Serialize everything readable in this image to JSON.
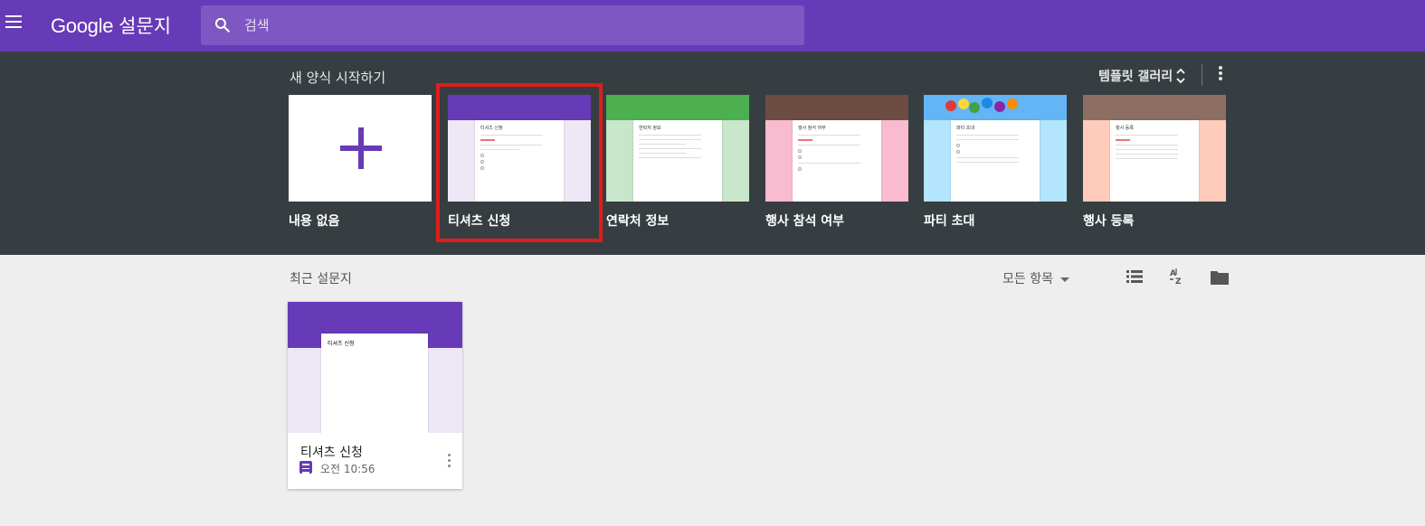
{
  "app": {
    "brand_google": "Google",
    "brand_product": "설문지",
    "accent_color": "#673ab7",
    "menu_icon": "hamburger-menu-icon"
  },
  "search": {
    "placeholder": "검색",
    "icon": "search-icon"
  },
  "templates": {
    "section_title": "새 양식 시작하기",
    "gallery_label": "템플릿 갤러리",
    "highlight_color": "#e21b1b",
    "items": [
      {
        "label": "내용 없음",
        "icon": "plus-icon"
      },
      {
        "label": "티셔츠 신청",
        "paper_title": "티셔츠 신청",
        "colors": [
          "#673ab7",
          "#ede7f6"
        ]
      },
      {
        "label": "연락처 정보",
        "paper_title": "연락처 정보",
        "colors": [
          "#4caf50",
          "#c8e6c9"
        ]
      },
      {
        "label": "행사 참석 여부",
        "paper_title": "행사 참석 여부",
        "colors": [
          "#6d4c41",
          "#f8bbd0"
        ]
      },
      {
        "label": "파티 초대",
        "paper_title": "파티 초대",
        "colors": [
          "#64b5f6",
          "#b3e5fc"
        ]
      },
      {
        "label": "행사 등록",
        "paper_title": "행사 등록",
        "colors": [
          "#8d6e63",
          "#ffccbc"
        ]
      }
    ]
  },
  "recent": {
    "section_title": "최근 설문지",
    "owner_filter": "모든 항목",
    "view_icons": [
      "list-view-icon",
      "sort-az-icon",
      "folder-icon"
    ],
    "files": [
      {
        "name": "티셔츠 신청",
        "time": "오전 10:56",
        "paper_title": "티셔츠 신청"
      }
    ]
  }
}
